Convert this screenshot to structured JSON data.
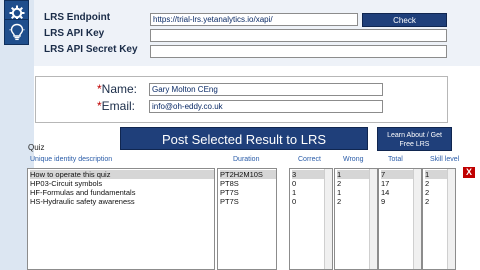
{
  "lrs": {
    "endpoint_label": "LRS Endpoint",
    "endpoint_value": "https://trial-lrs.yetanalytics.io/xapi/",
    "api_key_label": "LRS API Key",
    "api_key_value": "",
    "api_secret_label": "LRS API Secret Key",
    "api_secret_value": "",
    "check_label": "Check"
  },
  "user": {
    "name_label": "*Name:",
    "name_value": "Gary Molton CEng",
    "email_label": "*Email:",
    "email_value": "info@oh-eddy.co.uk"
  },
  "actions": {
    "post_label": "Post Selected Result to LRS",
    "learn_line1": "Learn About / Get",
    "learn_line2": "Free LRS",
    "delete_label": "X"
  },
  "quiz": {
    "label": "Quiz",
    "headers": {
      "description": "Unique identity description",
      "duration": "Duration",
      "correct": "Correct",
      "wrong": "Wrong",
      "total": "Total",
      "skill": "Skill level"
    },
    "rows": [
      {
        "description": "How to operate this quiz",
        "duration": "PT2H2M10S",
        "correct": "3",
        "wrong": "1",
        "total": "7",
        "skill": "1"
      },
      {
        "description": "HP03-Circuit symbols",
        "duration": "PT8S",
        "correct": "0",
        "wrong": "2",
        "total": "17",
        "skill": "2"
      },
      {
        "description": "HF-Formulas and fundamentals",
        "duration": "PT7S",
        "correct": "1",
        "wrong": "1",
        "total": "14",
        "skill": "2"
      },
      {
        "description": "HS-Hydraulic safety awareness",
        "duration": "PT7S",
        "correct": "0",
        "wrong": "2",
        "total": "9",
        "skill": "2"
      }
    ]
  },
  "icons": [
    "gear-icon",
    "lightbulb-icon"
  ],
  "colors": {
    "accent": "#1f3f7a",
    "delete": "#c00000"
  }
}
